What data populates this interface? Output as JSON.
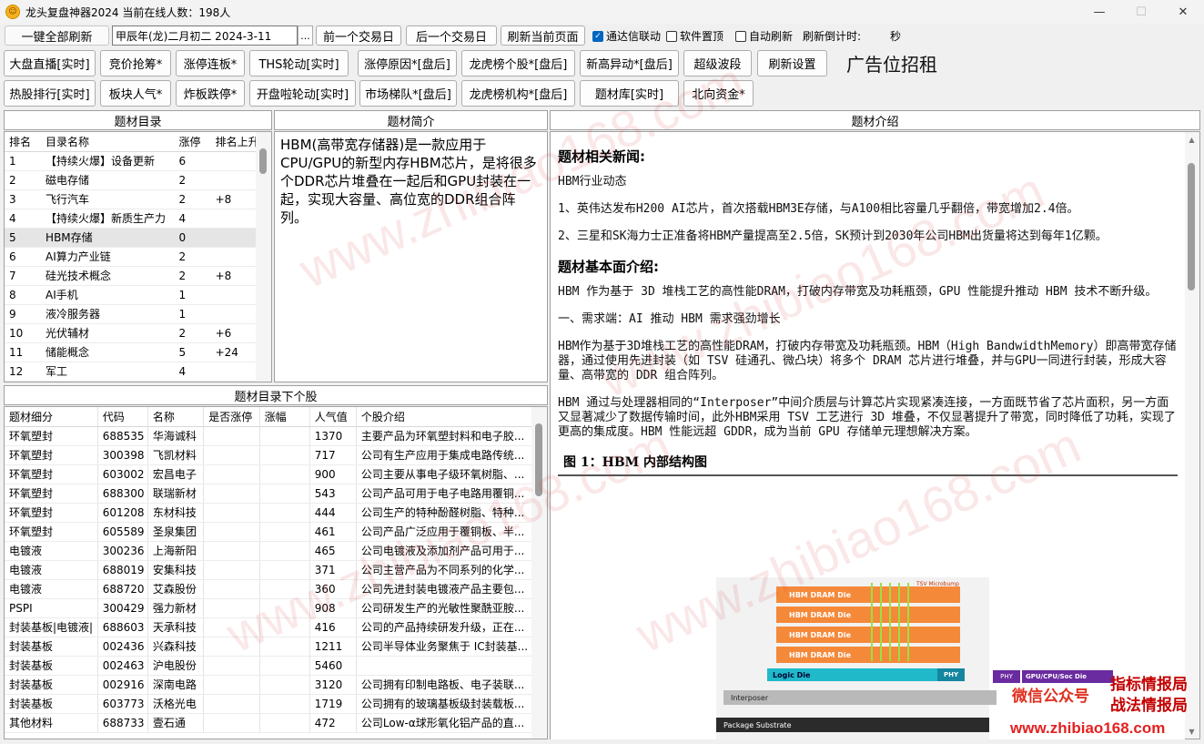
{
  "window": {
    "title": "龙头复盘神器2024 当前在线人数：198人",
    "icon": "app-logo-icon",
    "controls": [
      "—",
      "☐",
      "✕"
    ]
  },
  "toolbar": {
    "refresh_all": "一键全部刷新",
    "date_value": "甲辰年(龙)二月初二  2024-3-11",
    "date_picker": "...",
    "prev_day": "前一个交易日",
    "next_day": "后一个交易日",
    "refresh_page": "刷新当前页面",
    "check_tdx": "通达信联动",
    "check_top": "软件置顶",
    "check_auto": "自动刷新",
    "countdown_label": "刷新倒计时:",
    "countdown_unit": "秒",
    "ad": "广告位招租"
  },
  "nav_row1": [
    "大盘直播[实时]",
    "竞价抢筹*",
    "涨停连板*",
    "THS轮动[实时]",
    "涨停原因*[盘后]",
    "龙虎榜个股*[盘后]",
    "新高异动*[盘后]",
    "超级波段",
    "刷新设置"
  ],
  "nav_row2": [
    "热股排行[实时]",
    "板块人气*",
    "炸板跌停*",
    "开盘啦轮动[实时]",
    "市场梯队*[盘后]",
    "龙虎榜机构*[盘后]",
    "题材库[实时]",
    "北向资金*"
  ],
  "catalog": {
    "header": "题材目录",
    "columns": [
      "排名",
      "目录名称",
      "涨停",
      "排名上升"
    ],
    "rows": [
      [
        "1",
        "【持续火爆】设备更新",
        "6",
        ""
      ],
      [
        "2",
        "磁电存储",
        "2",
        ""
      ],
      [
        "3",
        "飞行汽车",
        "2",
        "+8"
      ],
      [
        "4",
        "【持续火爆】新质生产力",
        "4",
        ""
      ],
      [
        "5",
        "HBM存储",
        "0",
        ""
      ],
      [
        "6",
        "AI算力产业链",
        "2",
        ""
      ],
      [
        "7",
        "硅光技术概念",
        "2",
        "+8"
      ],
      [
        "8",
        "AI手机",
        "1",
        ""
      ],
      [
        "9",
        "液冷服务器",
        "1",
        ""
      ],
      [
        "10",
        "光伏辅材",
        "2",
        "+6"
      ],
      [
        "11",
        "储能概念",
        "5",
        "+24"
      ],
      [
        "12",
        "军工",
        "4",
        ""
      ]
    ],
    "selected_index": 4
  },
  "intro": {
    "header": "题材简介",
    "text": "HBM(高带宽存储器)是一款应用于CPU/GPU的新型内存HBM芯片，是将很多个DDR芯片堆叠在一起后和GPU封装在一起，实现大容量、高位宽的DDR组合阵列。"
  },
  "detail": {
    "header": "题材介绍",
    "news_title": "题材相关新闻:",
    "news_sub": "HBM行业动态",
    "news1": "1、英伟达发布H200 AI芯片，首次搭载HBM3E存储，与A100相比容量几乎翻倍，带宽增加2.4倍。",
    "news2": "2、三星和SK海力士正准备将HBM产量提高至2.5倍，SK预计到2030年公司HBM出货量将达到每年1亿颗。",
    "fund_title": "题材基本面介绍:",
    "p1": "HBM 作为基于 3D 堆栈工艺的高性能DRAM，打破内存带宽及功耗瓶颈，GPU 性能提升推动 HBM 技术不断升级。",
    "p2": "一、需求端：AI 推动 HBM 需求强劲增长",
    "p3": "HBM作为基于3D堆栈工艺的高性能DRAM，打破内存带宽及功耗瓶颈。HBM（High BandwidthMemory）即高带宽存储器，通过使用先进封装（如 TSV 硅通孔、微凸块）将多个 DRAM 芯片进行堆叠，并与GPU一同进行封装，形成大容量、高带宽的 DDR 组合阵列。",
    "p4": "HBM 通过与处理器相同的“Interposer”中间介质层与计算芯片实现紧凑连接，一方面既节省了芯片面积，另一方面又显著减少了数据传输时间，此外HBM采用 TSV 工艺进行 3D 堆叠，不仅显著提升了带宽，同时降低了功耗，实现了更高的集成度。HBM 性能远超 GDDR，成为当前 GPU 存储单元理想解决方案。",
    "fig_title": "图 1：HBM 内部结构图",
    "fig": {
      "die": "HBM DRAM Die",
      "tsv": "TSV Microbump",
      "logic": "Logic Die",
      "phy": "PHY",
      "phy2": "PHY",
      "gpu": "GPU/CPU/Soc Die",
      "interposer": "Interposer",
      "substrate": "Package Substrate"
    }
  },
  "stocks": {
    "header": "题材目录下个股",
    "columns": [
      "题材细分",
      "代码",
      "名称",
      "是否涨停",
      "涨幅",
      "人气值",
      "个股介绍"
    ],
    "rows": [
      [
        "环氧塑封",
        "688535",
        "华海诚科",
        "",
        "",
        "1370",
        "主要产品为环氧塑封料和电子胶..."
      ],
      [
        "环氧塑封",
        "300398",
        "飞凯材料",
        "",
        "",
        "717",
        "公司有生产应用于集成电路传统..."
      ],
      [
        "环氧塑封",
        "603002",
        "宏昌电子",
        "",
        "",
        "900",
        "公司主要从事电子级环氧树脂、..."
      ],
      [
        "环氧塑封",
        "688300",
        "联瑞新材",
        "",
        "",
        "543",
        "公司产品可用于电子电路用覆铜..."
      ],
      [
        "环氧塑封",
        "601208",
        "东材科技",
        "",
        "",
        "444",
        "公司生产的特种酚醛树脂、特种..."
      ],
      [
        "环氧塑封",
        "605589",
        "圣泉集团",
        "",
        "",
        "461",
        "公司产品广泛应用于覆铜板、半..."
      ],
      [
        "电镀液",
        "300236",
        "上海新阳",
        "",
        "",
        "465",
        "公司电镀液及添加剂产品可用于..."
      ],
      [
        "电镀液",
        "688019",
        "安集科技",
        "",
        "",
        "371",
        "公司主营产品为不同系列的化学..."
      ],
      [
        "电镀液",
        "688720",
        "艾森股份",
        "",
        "",
        "360",
        "公司先进封装电镀液产品主要包..."
      ],
      [
        "PSPI",
        "300429",
        "强力新材",
        "",
        "",
        "908",
        "公司研发生产的光敏性聚酰亚胺..."
      ],
      [
        "封装基板|电镀液|",
        "688603",
        "天承科技",
        "",
        "",
        "416",
        "公司的产品持续研发升级，正在..."
      ],
      [
        "封装基板",
        "002436",
        "兴森科技",
        "",
        "",
        "1211",
        "公司半导体业务聚焦于 IC封装基..."
      ],
      [
        "封装基板",
        "002463",
        "沪电股份",
        "",
        "",
        "5460",
        ""
      ],
      [
        "封装基板",
        "002916",
        "深南电路",
        "",
        "",
        "3120",
        "公司拥有印制电路板、电子装联..."
      ],
      [
        "封装基板",
        "603773",
        "沃格光电",
        "",
        "",
        "1719",
        "公司拥有的玻璃基板级封装载板..."
      ],
      [
        "其他材料",
        "688733",
        "壹石通",
        "",
        "",
        "472",
        "公司Low-α球形氧化铝产品的直..."
      ]
    ]
  },
  "watermarks": {
    "wm1": "www.zhibiao168.com",
    "wm2": "www.zhibiao168.com",
    "wm3": "www.zhibiao168.com",
    "wm4": "www.zhibiao168.com",
    "brand1": "微信公众号",
    "brand2a": "指标情报局",
    "brand2b": "战法情报局",
    "brand3": "www.zhibiao168.com"
  }
}
